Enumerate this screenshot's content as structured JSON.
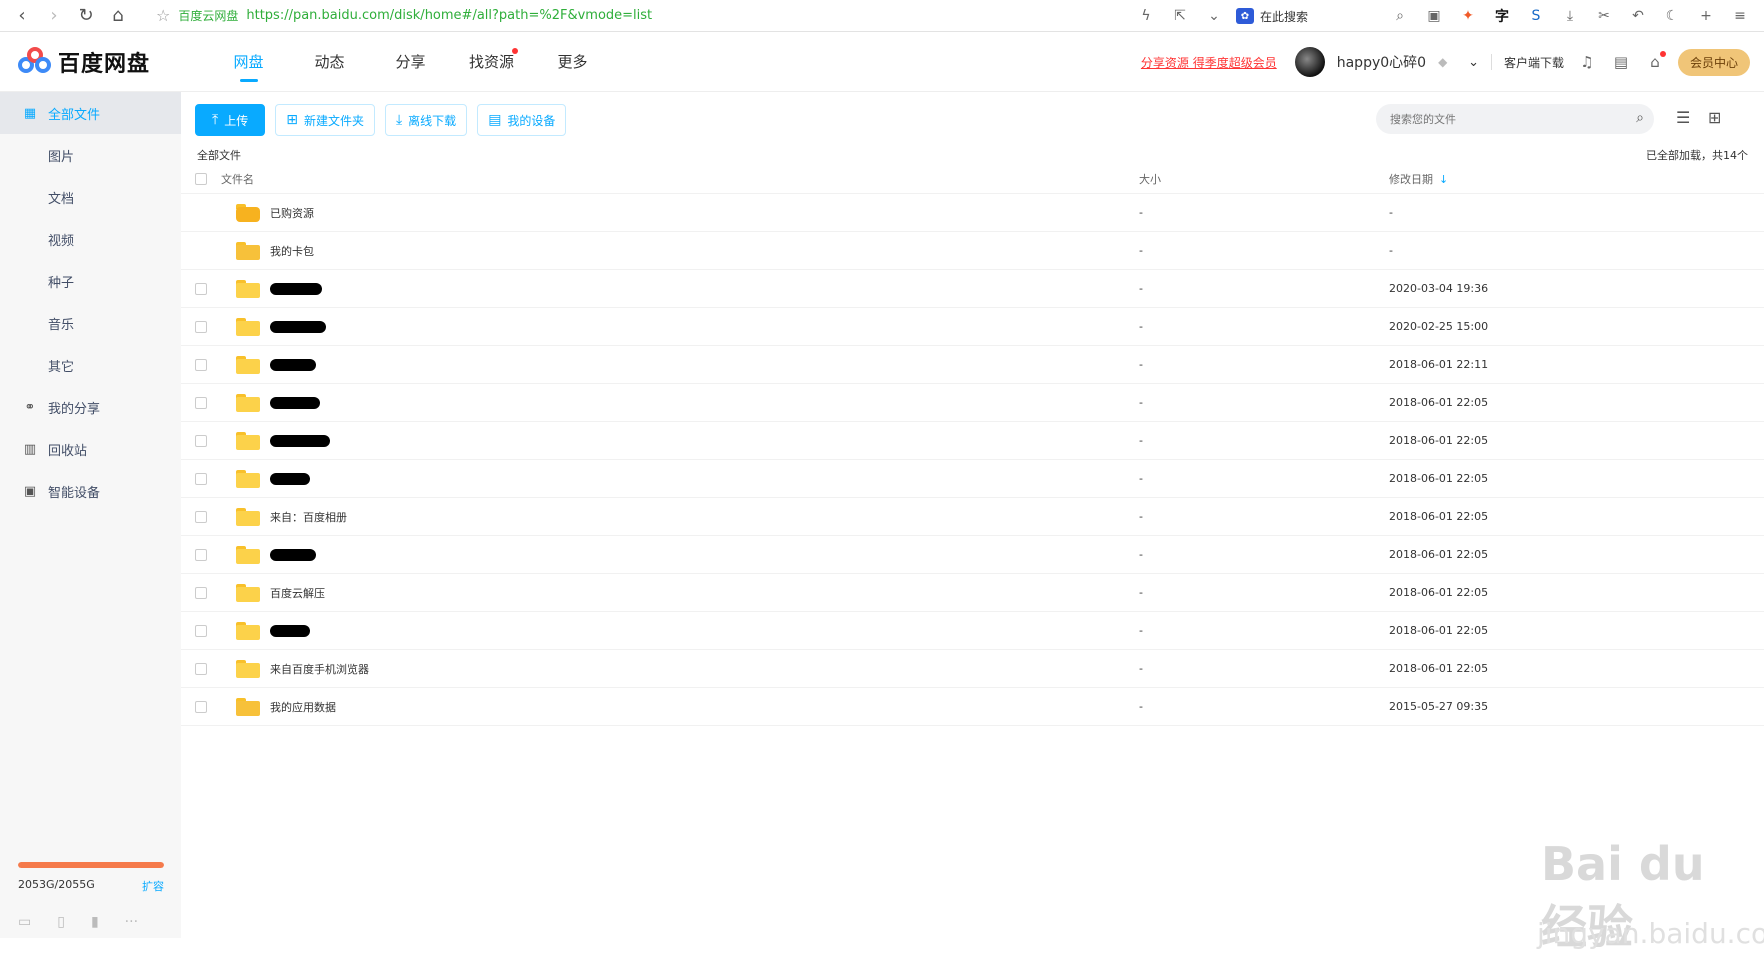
{
  "browser": {
    "site_name": "百度云网盘",
    "url": "https://pan.baidu.com/disk/home#/all?path=%2F&vmode=list",
    "search_label": "在此搜索"
  },
  "header": {
    "brand": "百度网盘",
    "nav": [
      {
        "label": "网盘",
        "active": true
      },
      {
        "label": "动态"
      },
      {
        "label": "分享"
      },
      {
        "label": "找资源",
        "dot": true
      },
      {
        "label": "更多"
      }
    ],
    "promo": "分享资源 得季度超级会员",
    "username": "happy0心碎0",
    "client_download": "客户端下载",
    "vip_center": "会员中心"
  },
  "sidebar": {
    "items": [
      {
        "label": "全部文件",
        "active": true,
        "icon": "file-icon"
      },
      {
        "label": "图片"
      },
      {
        "label": "文档"
      },
      {
        "label": "视频"
      },
      {
        "label": "种子"
      },
      {
        "label": "音乐"
      },
      {
        "label": "其它"
      },
      {
        "label": "我的分享",
        "icon": "share-icon"
      },
      {
        "label": "回收站",
        "icon": "trash-icon"
      },
      {
        "label": "智能设备",
        "icon": "device-icon"
      }
    ],
    "quota": {
      "text": "2053G/2055G",
      "expand": "扩容",
      "used_fraction": 0.999
    }
  },
  "toolbar": {
    "upload": "上传",
    "new_folder": "新建文件夹",
    "offline_download": "离线下载",
    "my_devices": "我的设备",
    "search_placeholder": "搜索您的文件"
  },
  "list": {
    "breadcrumb": "全部文件",
    "loaded_text": "已全部加载，共14个",
    "columns": {
      "name": "文件名",
      "size": "大小",
      "date": "修改日期"
    },
    "rows": [
      {
        "name": "已购资源",
        "size": "-",
        "date": "-",
        "kind": "bag",
        "checkbox": false
      },
      {
        "name": "我的卡包",
        "size": "-",
        "date": "-",
        "kind": "special",
        "checkbox": false
      },
      {
        "name": "",
        "redacted": 52,
        "size": "-",
        "date": "2020-03-04 19:36"
      },
      {
        "name": "",
        "redacted": 56,
        "size": "-",
        "date": "2020-02-25 15:00"
      },
      {
        "name": "",
        "redacted": 46,
        "size": "-",
        "date": "2018-06-01 22:11"
      },
      {
        "name": "",
        "redacted": 50,
        "size": "-",
        "date": "2018-06-01 22:05"
      },
      {
        "name": "",
        "redacted": 60,
        "size": "-",
        "date": "2018-06-01 22:05"
      },
      {
        "name": "",
        "redacted": 40,
        "size": "-",
        "date": "2018-06-01 22:05"
      },
      {
        "name": "来自：百度相册",
        "size": "-",
        "date": "2018-06-01 22:05"
      },
      {
        "name": "",
        "redacted": 46,
        "size": "-",
        "date": "2018-06-01 22:05"
      },
      {
        "name": "百度云解压",
        "size": "-",
        "date": "2018-06-01 22:05"
      },
      {
        "name": "",
        "redacted": 40,
        "size": "-",
        "date": "2018-06-01 22:05"
      },
      {
        "name": "来自百度手机浏览器",
        "size": "-",
        "date": "2018-06-01 22:05"
      },
      {
        "name": "我的应用数据",
        "size": "-",
        "date": "2015-05-27 09:35",
        "kind": "special"
      }
    ]
  },
  "watermark": {
    "main": "Bai du 经验",
    "sub": "jingyan.baidu.com"
  }
}
